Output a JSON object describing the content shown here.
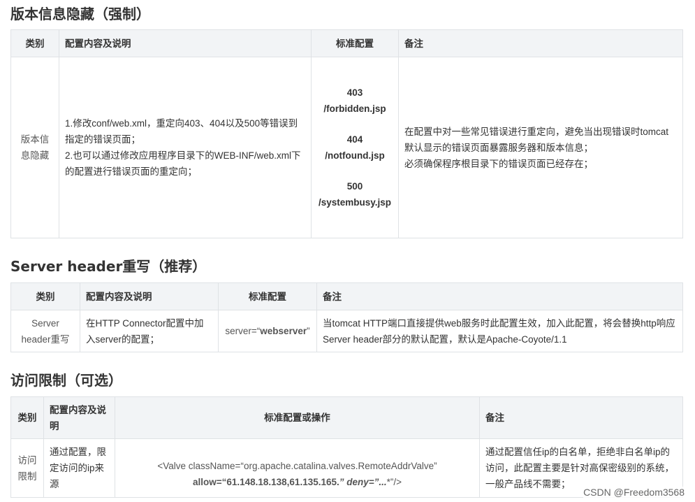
{
  "sections": [
    {
      "title": "版本信息隐藏（强制）",
      "headers": [
        "类别",
        "配置内容及说明",
        "标准配置",
        "备注"
      ],
      "row": {
        "category": "版本信息隐藏",
        "desc_lines": [
          "1.修改conf/web.xml，重定向403、404以及500等错误到指定的错误页面；",
          "2.也可以通过修改应用程序目录下的WEB-INF/web.xml下的配置进行错误页面的重定向；"
        ],
        "standard": [
          "403 /forbidden.jsp",
          "404 /notfound.jsp",
          "500 /systembusy.jsp"
        ],
        "remarks": [
          "在配置中对一些常见错误进行重定向，避免当出现错误时tomcat默认显示的错误页面暴露服务器和版本信息；",
          "必须确保程序根目录下的错误页面已经存在；"
        ]
      }
    },
    {
      "title": "Server header重写（推荐）",
      "headers": [
        "类别",
        "配置内容及说明",
        "标准配置",
        "备注"
      ],
      "row": {
        "category": "Server header重写",
        "desc": "在HTTP Connector配置中加入server的配置；",
        "standard_prefix": "server=“",
        "standard_value": "webserver",
        "standard_suffix": "”",
        "remarks": "当tomcat HTTP端口直接提供web服务时此配置生效，加入此配置，将会替换http响应Server header部分的默认配置，默认是Apache-Coyote/1.1"
      }
    },
    {
      "title": "访问限制（可选）",
      "headers": [
        "类别",
        "配置内容及说明",
        "标准配置或操作",
        "备注"
      ],
      "row": {
        "category": "访问限制",
        "desc": "通过配置，限定访问的ip来源",
        "standard_line1": "<Valve className=“org.apache.catalina.valves.RemoteAddrValve”",
        "standard_allow": "allow=“61.148.18.138,61.135.165.",
        "standard_deny": "” deny=”...",
        "standard_end": "*”/>",
        "remarks": "通过配置信任ip的白名单，拒绝非白名单ip的访问，此配置主要是针对高保密级别的系统，一般产品线不需要；"
      }
    }
  ],
  "watermark": "CSDN @Freedom3568"
}
